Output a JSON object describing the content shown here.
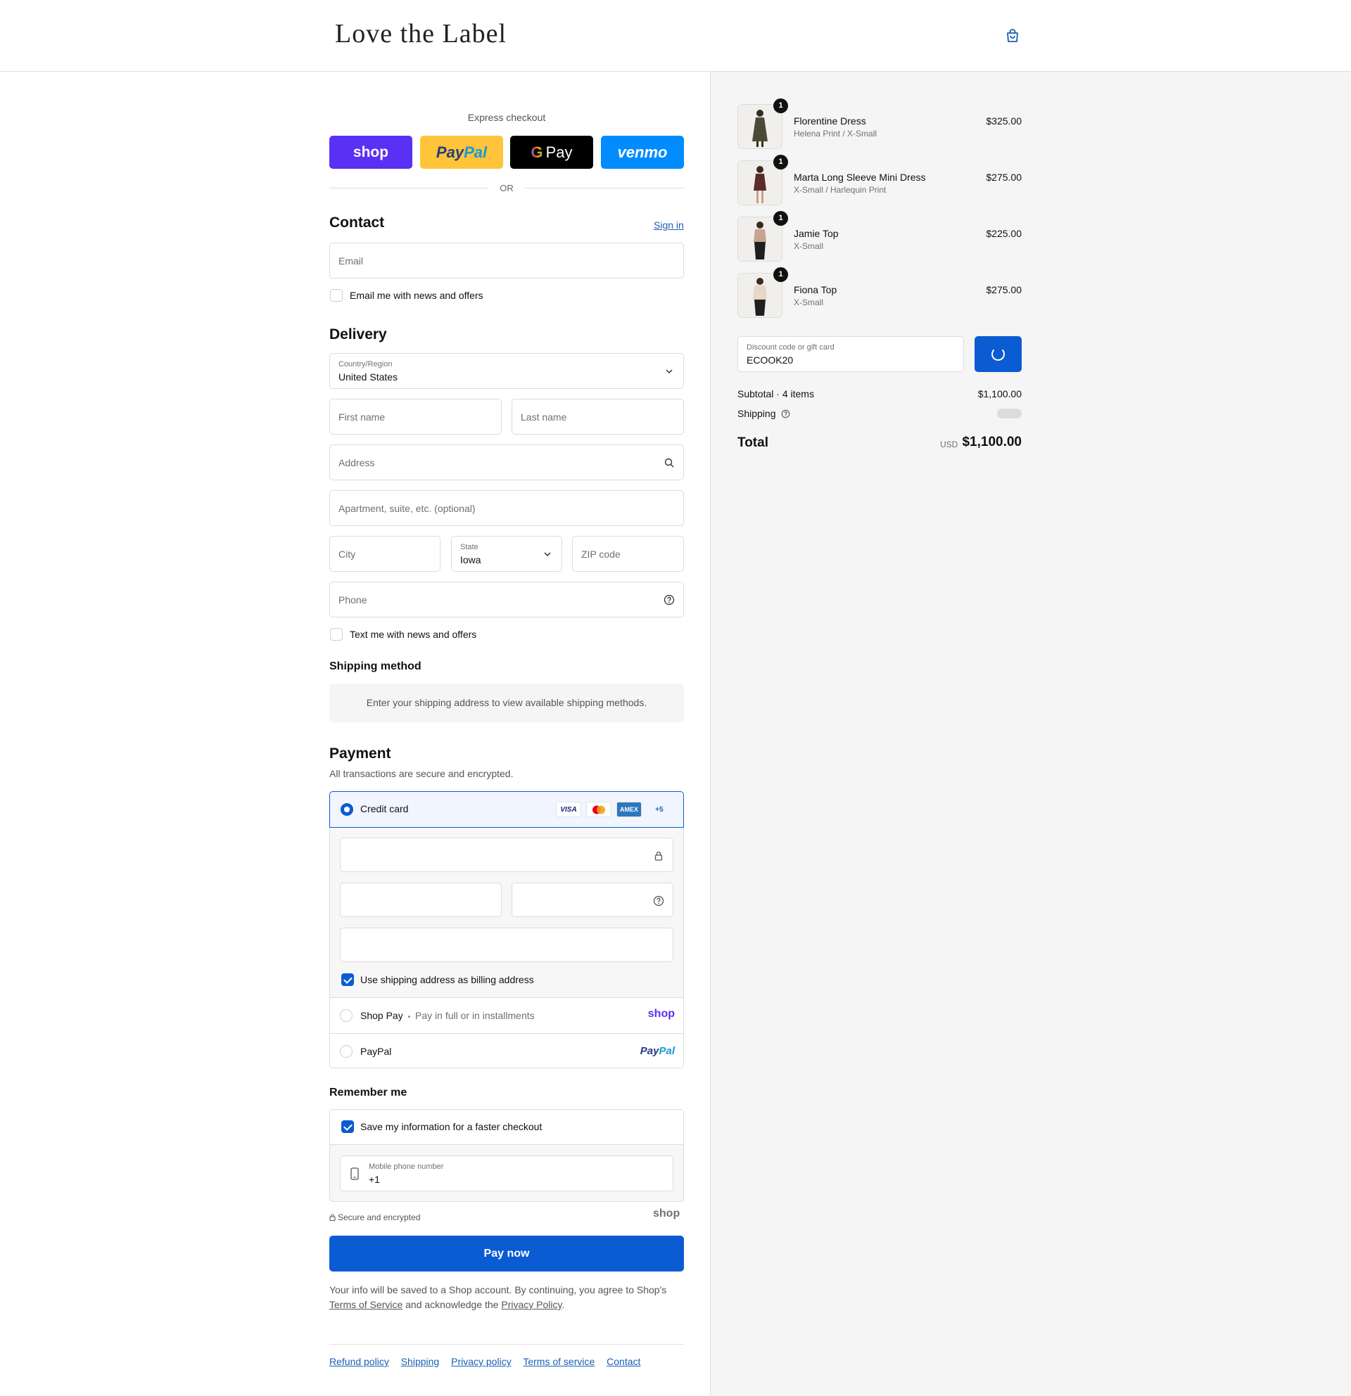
{
  "brand": {
    "name": "Love the Label"
  },
  "express": {
    "title": "Express checkout",
    "buttons": {
      "shop": "shop",
      "paypal_a": "Pay",
      "paypal_b": "Pal",
      "gpay_g": "G",
      "gpay_text": "Pay",
      "venmo": "venmo"
    },
    "or": "OR"
  },
  "contact": {
    "title": "Contact",
    "sign_in": "Sign in",
    "email_placeholder": "Email",
    "newsletter": "Email me with news and offers"
  },
  "delivery": {
    "title": "Delivery",
    "country_label": "Country/Region",
    "country_value": "United States",
    "first_name": "First name",
    "last_name": "Last name",
    "address": "Address",
    "apartment": "Apartment, suite, etc. (optional)",
    "city": "City",
    "state_label": "State",
    "state_value": "Iowa",
    "zip": "ZIP code",
    "phone": "Phone",
    "sms_opt_in": "Text me with news and offers"
  },
  "shipping_method": {
    "title": "Shipping method",
    "message": "Enter your shipping address to view available shipping methods."
  },
  "payment": {
    "title": "Payment",
    "subtitle": "All transactions are secure and encrypted.",
    "credit_card": "Credit card",
    "card_brands": [
      "VISA",
      "AMEX",
      "+5"
    ],
    "billing_same": "Use shipping address as billing address",
    "shop_pay": "Shop Pay",
    "shop_pay_sep": "•",
    "shop_pay_desc": "Pay in full or in installments",
    "shop_logo": "shop",
    "paypal": "PayPal",
    "paypal_logo_a": "Pay",
    "paypal_logo_b": "Pal"
  },
  "remember": {
    "title": "Remember me",
    "save_info": "Save my information for a faster checkout",
    "phone_label": "Mobile phone number",
    "phone_value": "+1"
  },
  "secure_note": "Secure and encrypted",
  "shop_grey": "shop",
  "pay_now": "Pay now",
  "legal": {
    "before": "Your info will be saved to a Shop account. By continuing, you agree to Shop's",
    "terms": "Terms of Service",
    "middle": "and acknowledge the",
    "privacy": "Privacy Policy",
    "end": "."
  },
  "footer": [
    "Refund policy",
    "Shipping",
    "Privacy policy",
    "Terms of service",
    "Contact"
  ],
  "cart": {
    "items": [
      {
        "qty": "1",
        "name": "Florentine Dress",
        "variant": "Helena Print / X-Small",
        "price": "$325.00",
        "color": "#4b4a36"
      },
      {
        "qty": "1",
        "name": "Marta Long Sleeve Mini Dress",
        "variant": "X-Small / Harlequin Print",
        "price": "$275.00",
        "color": "#5a2c2a"
      },
      {
        "qty": "1",
        "name": "Jamie Top",
        "variant": "X-Small",
        "price": "$225.00",
        "color": "#c9a38d"
      },
      {
        "qty": "1",
        "name": "Fiona Top",
        "variant": "X-Small",
        "price": "$275.00",
        "color": "#e8d6c8"
      }
    ],
    "discount_label": "Discount code or gift card",
    "discount_value": "ECOOK20",
    "subtotal_label": "Subtotal · 4 items",
    "subtotal_value": "$1,100.00",
    "shipping_label": "Shipping",
    "total_label": "Total",
    "currency": "USD",
    "total_value": "$1,100.00"
  }
}
